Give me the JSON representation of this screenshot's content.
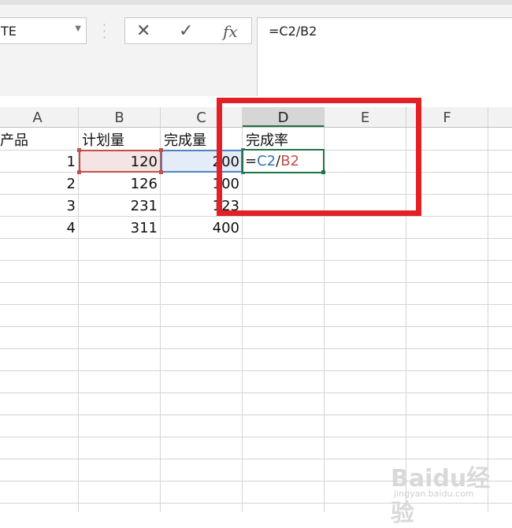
{
  "name_box": {
    "value": "TE"
  },
  "formula_bar": {
    "cancel_symbol": "✕",
    "enter_symbol": "✓",
    "fx_label": "fx",
    "formula": "=C2/B2"
  },
  "columns": [
    "A",
    "B",
    "C",
    "D",
    "E",
    "F"
  ],
  "active_column": "D",
  "rows": [
    [
      "产品",
      "计划量",
      "完成量",
      "完成率"
    ],
    [
      "1",
      "120",
      "200",
      ""
    ],
    [
      "2",
      "126",
      "100",
      ""
    ],
    [
      "3",
      "231",
      "123",
      ""
    ],
    [
      "4",
      "311",
      "400",
      ""
    ]
  ],
  "active_cell_formula": {
    "eq": "=",
    "ref1": "C2",
    "slash": "/",
    "ref2": "B2"
  },
  "colors": {
    "accent_green": "#217346",
    "ref_red": "#c0504d",
    "ref_blue": "#2e75b6",
    "highlight_red": "#e32026"
  },
  "watermark": {
    "main": "Baidu经验",
    "sub": "jingyan.baidu.com"
  }
}
